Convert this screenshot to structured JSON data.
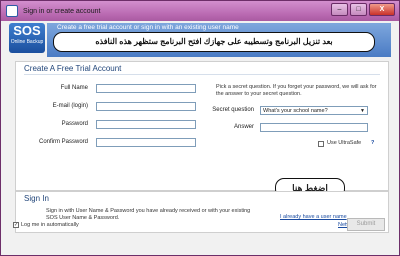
{
  "window": {
    "title": "Sign in or create account",
    "minimize": "–",
    "maximize": "□",
    "close": "X"
  },
  "logo": {
    "big": "SOS",
    "small": "Online Backup"
  },
  "header": {
    "text": "Create a free trial account or sign in with an existing user name",
    "annotation": "بعد تنزيل البرنامج وتسطيبه على جهازك افتح البرنامج ستظهر هذه النافذه"
  },
  "create": {
    "title": "Create A Free Trial Account",
    "full_name_label": "Full Name",
    "email_label": "E-mail (login)",
    "password_label": "Password",
    "confirm_label": "Confirm Password",
    "hint": "Pick a secret question. If you forget your password, we will ask for the answer to your secret question.",
    "secret_label": "Secret question",
    "secret_value": "What's your school name?",
    "answer_label": "Answer",
    "ultrasafe_label": "Use UltraSafe"
  },
  "signin": {
    "title": "Sign In",
    "text": "Sign in with User Name & Password you have already received or with your existing SOS User Name & Password.",
    "link": "I already have a user name",
    "annotation": "اضغط هنا"
  },
  "footer": {
    "log_me_in": "Log me in automatically",
    "network_settings": "Network Settings...",
    "submit": "Submit"
  }
}
